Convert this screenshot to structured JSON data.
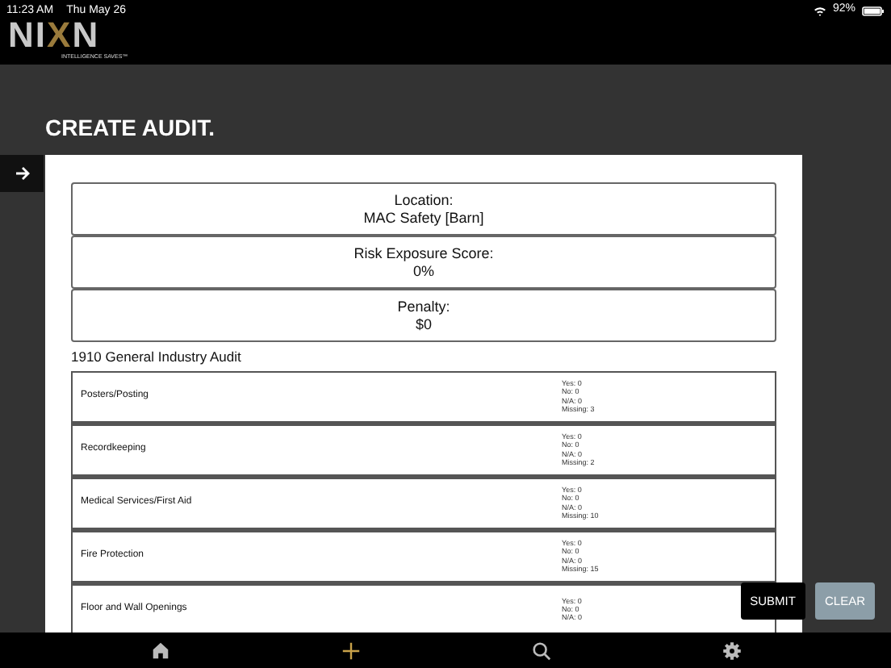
{
  "status_bar": {
    "time": "11:23 AM",
    "date": "Thu May 26",
    "battery": "92%"
  },
  "logo": {
    "letters": [
      {
        "text": "N",
        "color": "#c8c8c8"
      },
      {
        "text": "I",
        "color": "#c8c8c8"
      },
      {
        "text": "X",
        "color": "#9a7b3c"
      },
      {
        "text": "N",
        "color": "#c8c8c8"
      }
    ],
    "tagline": "INTELLIGENCE SAVES™"
  },
  "page_title": "CREATE AUDIT.",
  "summary": [
    {
      "label": "Location:",
      "value": "MAC Safety [Barn]"
    },
    {
      "label": "Risk Exposure Score:",
      "value": "0%"
    },
    {
      "label": "Penalty:",
      "value": "$0"
    }
  ],
  "section_title": "1910 General Industry Audit",
  "categories": [
    {
      "name": "Posters/Posting",
      "counts": [
        "Yes: 0",
        "No: 0",
        "N/A: 0",
        "Missing: 3"
      ]
    },
    {
      "name": "Recordkeeping",
      "counts": [
        "Yes: 0",
        "No: 0",
        "N/A: 0",
        "Missing: 2"
      ]
    },
    {
      "name": "Medical Services/First Aid",
      "counts": [
        "Yes: 0",
        "No: 0",
        "N/A: 0",
        "Missing: 10"
      ]
    },
    {
      "name": "Fire Protection",
      "counts": [
        "Yes: 0",
        "No: 0",
        "N/A: 0",
        "Missing: 15"
      ]
    },
    {
      "name": "Floor and Wall Openings",
      "counts": [
        "Yes: 0",
        "No: 0",
        "N/A: 0"
      ]
    }
  ],
  "buttons": [
    {
      "label": "SUBMIT",
      "kind": "primary"
    },
    {
      "label": "CLEAR",
      "kind": "secondary"
    }
  ],
  "tab_bar": [
    {
      "kind": "home"
    },
    {
      "kind": "add"
    },
    {
      "kind": "search"
    },
    {
      "kind": "settings"
    }
  ]
}
